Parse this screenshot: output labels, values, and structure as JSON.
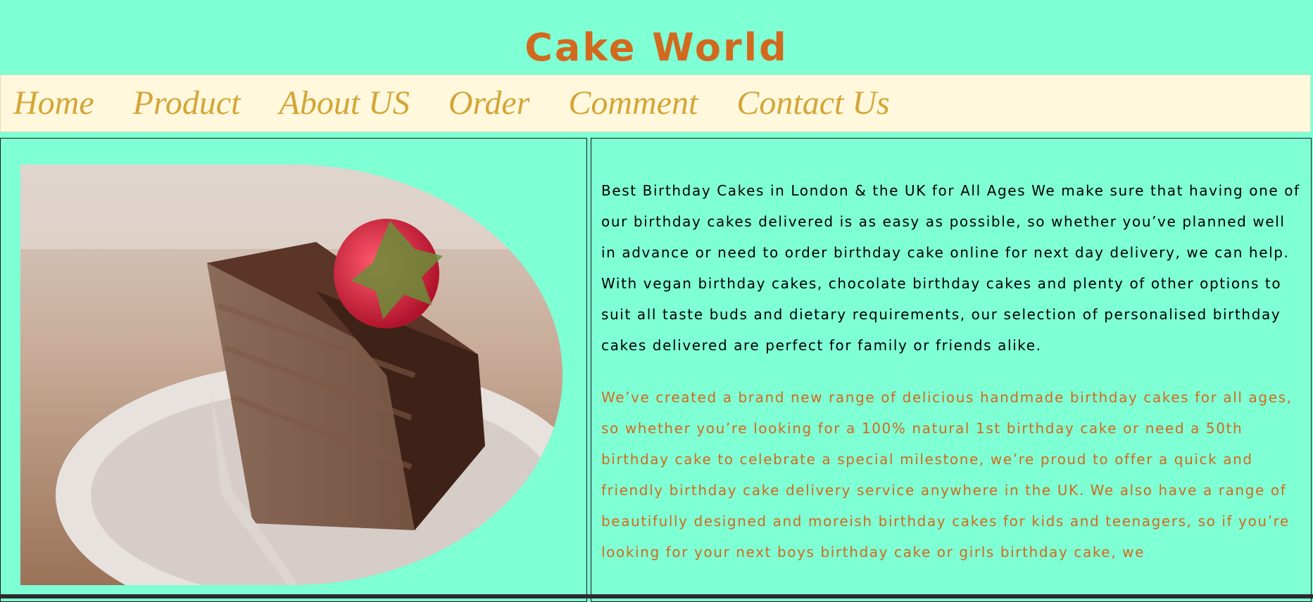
{
  "site": {
    "title": "Cake World",
    "title_color": "#d2691e"
  },
  "nav": {
    "items": [
      {
        "label": "Home"
      },
      {
        "label": "Product"
      },
      {
        "label": "About US"
      },
      {
        "label": "Order"
      },
      {
        "label": "Comment"
      },
      {
        "label": "Contact Us"
      }
    ],
    "color": "#d4a537",
    "background": "#fff8dc"
  },
  "main": {
    "image_icon": "chocolate-cake-slice-with-strawberry",
    "paragraphs": [
      "Best Birthday Cakes in London & the UK for All Ages We make sure that having one of our birthday cakes delivered is as easy as possible, so whether you’ve planned well in advance or need to order birthday cake online for next day delivery, we can help. With vegan birthday cakes, chocolate birthday cakes and plenty of other options to suit all taste buds and dietary requirements, our selection of personalised birthday cakes delivered are perfect for family or friends alike.",
      "We’ve created a brand new range of delicious handmade birthday cakes for all ages, so whether you’re looking for a 100% natural 1st birthday cake or need a 50th birthday cake to celebrate a special milestone, we’re proud to offer a quick and friendly birthday cake delivery service anywhere in the UK. We also have a range of beautifully designed and moreish birthday cakes for kids and teenagers, so if you’re looking for your next boys birthday cake or girls birthday cake, we"
    ]
  },
  "colors": {
    "page_background": "#7fffd4",
    "para_1": "#000000",
    "para_2": "#d2691e"
  }
}
